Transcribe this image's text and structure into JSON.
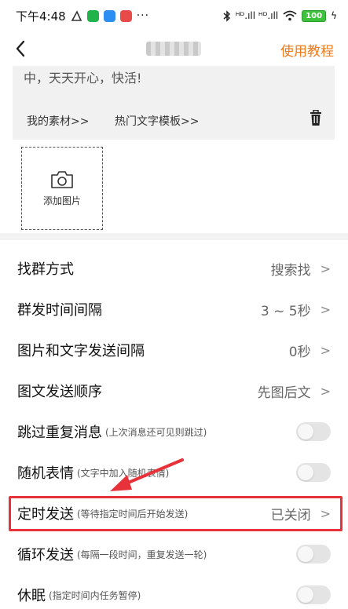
{
  "status_bar": {
    "time": "下午4:48",
    "more": "···",
    "battery": "100",
    "signal": "ᴴᴰ.ıll ᴴᴰ.ıll"
  },
  "navbar": {
    "back_icon": "‹",
    "tutorial": "使用教程"
  },
  "editor": {
    "content": "中，天天开心，快活!",
    "my_material": "我的素材>>",
    "hot_templates": "热门文字模板>>"
  },
  "add_image": {
    "label": "添加图片"
  },
  "settings": [
    {
      "label": "找群方式",
      "hint": "",
      "value": "搜索找",
      "type": "nav"
    },
    {
      "label": "群发时间间隔",
      "hint": "",
      "value": "3 ~ 5秒",
      "type": "nav"
    },
    {
      "label": "图片和文字发送间隔",
      "hint": "",
      "value": "0秒",
      "type": "nav"
    },
    {
      "label": "图文发送顺序",
      "hint": "",
      "value": "先图后文",
      "type": "nav"
    },
    {
      "label": "跳过重复消息",
      "hint": "(上次消息还可见则跳过)",
      "value": "",
      "type": "toggle",
      "on": false
    },
    {
      "label": "随机表情",
      "hint": "(文字中加入随机表情)",
      "value": "",
      "type": "toggle",
      "on": false
    },
    {
      "label": "定时发送",
      "hint": "(等待指定时间后开始发送)",
      "value": "已关闭",
      "type": "nav"
    },
    {
      "label": "循环发送",
      "hint": "(每隔一段时间，重复发送一轮)",
      "value": "",
      "type": "toggle",
      "on": false
    },
    {
      "label": "休眠",
      "hint": "(指定时间内任务暂停)",
      "value": "",
      "type": "toggle",
      "on": false
    }
  ],
  "colors": {
    "accent": "#ee7a1a",
    "highlight": "#e8323a"
  }
}
